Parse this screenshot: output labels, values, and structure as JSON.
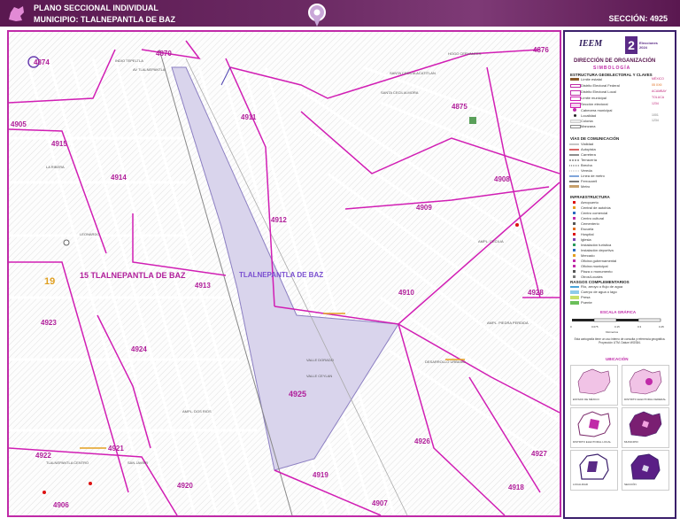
{
  "header": {
    "title_line1": "PLANO SECCIONAL INDIVIDUAL",
    "title_line2": "MUNICIPIO: TLALNEPANTLA DE BAZ",
    "section_label": "SECCIÓN: 4925"
  },
  "map": {
    "sections": [
      "4870",
      "4876",
      "4875",
      "4874",
      "4911",
      "4914",
      "4915",
      "4913",
      "4912",
      "4909",
      "4908",
      "4910",
      "4923",
      "4924",
      "4925",
      "4921",
      "4922",
      "4920",
      "4919",
      "4926",
      "4927",
      "4928",
      "4918",
      "4907",
      "4906",
      "4905"
    ],
    "municipality_labels": [
      "15 TLALNEPANTLA DE BAZ",
      "TLALNEPANTLA DE BAZ"
    ],
    "district_number": "19",
    "streets": [
      "SANTA CECILIA ACATITLAN",
      "SANTA CECILIA MORA",
      "INDIO TEPELTLA",
      "AV TLALNEPANTLA",
      "LA RIBERA",
      "LEONARDO",
      "VALLE DORADO",
      "TLALNEPANTLA CENTRO",
      "SAN JAVIER",
      "AMPL. DOS RIOS",
      "AMPL. PIEDRA PERDIDA",
      "HOGO CERVANTES",
      "VALLE CEYLAN",
      "AMPL. CECILIA",
      "DESARROLLO URBANO"
    ]
  },
  "legend": {
    "org": "IEEM",
    "org_tagline": "Elecciones 2024",
    "title": "DIRECCIÓN DE ORGANIZACIÓN",
    "subtitle": "SIMBOLOGÍA",
    "section1_title": "ESTRUCTURA GEOELECTORAL Y CLAVES",
    "items1": [
      {
        "label": "Límite estatal",
        "code": "MÉXICO"
      },
      {
        "label": "Distrito Electoral Federal",
        "code": "05 XXII"
      },
      {
        "label": "Distrito Electoral Local",
        "code": "ACAMBAY"
      },
      {
        "label": "Límite municipal",
        "code": "TOLUCA"
      },
      {
        "label": "Sección electoral",
        "code": "1234"
      },
      {
        "label": "Cabecera municipal",
        "code": ""
      },
      {
        "label": "Localidad",
        "code": "1001"
      },
      {
        "label": "Colonia",
        "code": "1234"
      },
      {
        "label": "Manzana",
        "code": ""
      }
    ],
    "section2_title": "VÍAS DE COMUNICACIÓN",
    "items2": [
      "Vialidad",
      "Autopista",
      "Carretera",
      "Terracería",
      "Brecha",
      "Vereda",
      "Línea de metro",
      "Ferrocarril",
      "Metro"
    ],
    "section3_title": "INFRAESTRUCTURA",
    "items3": [
      "Aeropuerto",
      "Central de autobús",
      "Centro comercial",
      "Centro cultural",
      "Cementerio",
      "Escuela",
      "Hospital",
      "Iglesia",
      "Instalación turística",
      "Instalación deportiva",
      "Mercado",
      "Oficina gubernamental",
      "Oficina municipal",
      "Plaza o monumento",
      "Otros/Locales"
    ],
    "section4_title": "RASGOS COMPLEMENTARIOS",
    "items4": [
      "Río, arroyo o flujo de agua",
      "Cuerpo de agua o lago",
      "Presa",
      "Puente"
    ],
    "scale_title": "ESCALA GRÁFICA",
    "scale_ticks": [
      "0",
      "0.075",
      "0.15",
      "0.3",
      "0.45"
    ],
    "scale_unit": "Kilómetros",
    "notes": "Esta cartografía tiene un uso interno de consulta y referencia geográfica. Proyección UTM. Datum WGS84.",
    "location_title": "UBICACIÓN",
    "minimap_captions": [
      "ESTADO DE MÉXICO",
      "DISTRITO ELECTORAL FEDERAL",
      "DISTRITO ELECTORAL LOCAL",
      "MUNICIPIO",
      "LOCALIDAD",
      "SECCIÓN"
    ],
    "colors": {
      "primary": "#5a1850",
      "accent": "#c02aa8",
      "section_fill": "#d9d4ec"
    }
  }
}
